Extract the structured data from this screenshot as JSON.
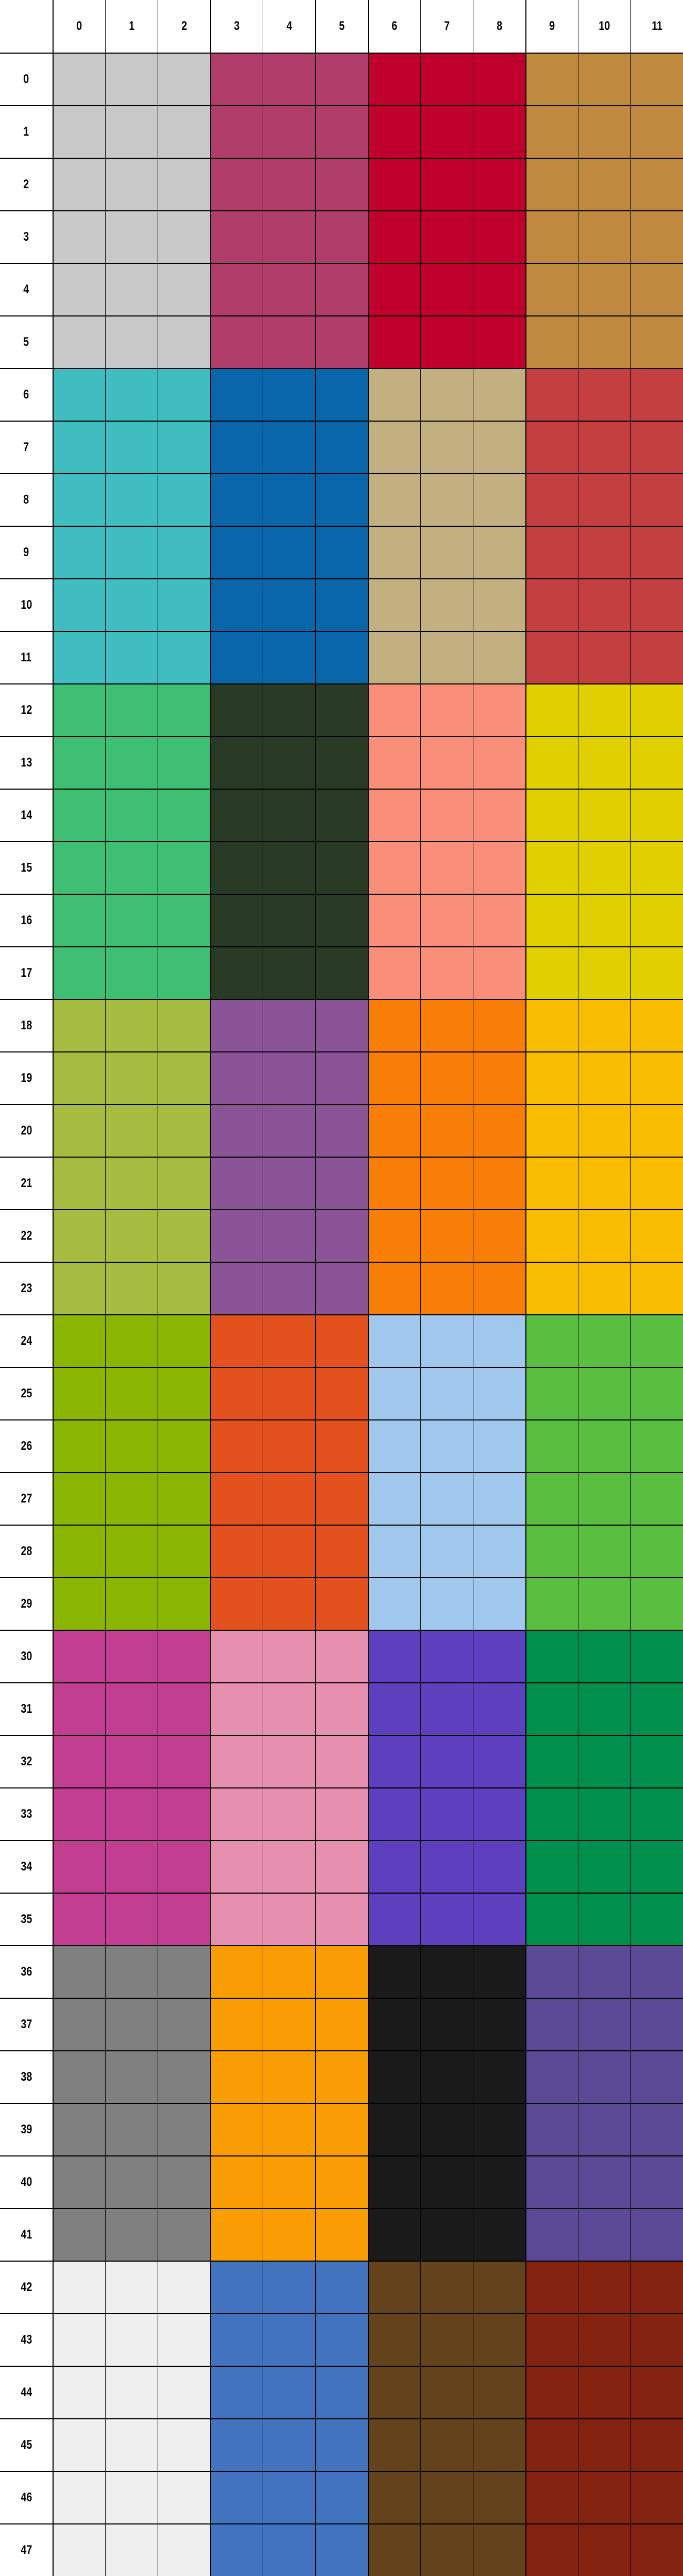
{
  "columns": [
    "0",
    "1",
    "2",
    "3",
    "4",
    "5",
    "6",
    "7",
    "8",
    "9",
    "10",
    "11"
  ],
  "rows": [
    "0",
    "1",
    "2",
    "3",
    "4",
    "5",
    "6",
    "7",
    "8",
    "9",
    "10",
    "11",
    "12",
    "13",
    "14",
    "15",
    "16",
    "17",
    "18",
    "19",
    "20",
    "21",
    "22",
    "23",
    "24",
    "25",
    "26",
    "27",
    "28",
    "29",
    "30",
    "31",
    "32",
    "33",
    "34",
    "35",
    "36",
    "37",
    "38",
    "39",
    "40",
    "41",
    "42",
    "43",
    "44",
    "45",
    "46",
    "47"
  ],
  "block_size": 3,
  "block_rows": 6,
  "bands": [
    [
      "#c8c8c8",
      "#b13e6a",
      "#c0002d",
      "#bf8a40"
    ],
    [
      "#3fbdc1",
      "#0a66aa",
      "#c2b080",
      "#c44040"
    ],
    [
      "#3fbf74",
      "#283a23",
      "#f98f78",
      "#e0d000"
    ],
    [
      "#a6bc40",
      "#8a5496",
      "#f97e07",
      "#f8bd00"
    ],
    [
      "#8bb503",
      "#e3521e",
      "#9fc8ec",
      "#5abe41"
    ],
    [
      "#c13e91",
      "#e78fae",
      "#5e3fbe",
      "#018f4d"
    ],
    [
      "#808080",
      "#f99d03",
      "#1a1a1a",
      "#5c4a96"
    ],
    [
      "#efefef",
      "#4173bf",
      "#64421c",
      "#852311"
    ]
  ]
}
